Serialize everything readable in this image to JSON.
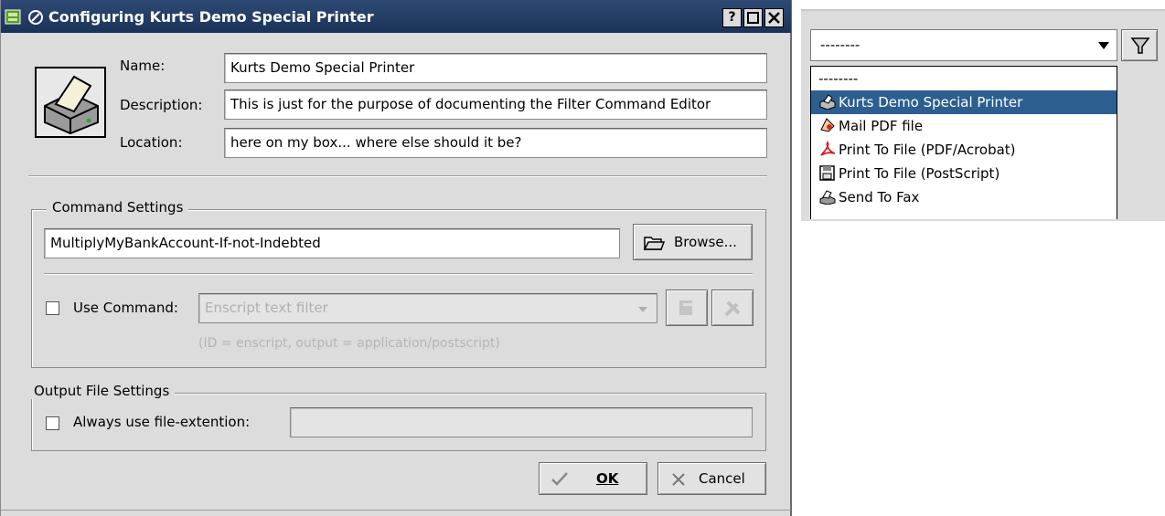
{
  "window": {
    "title": "Configuring Kurts Demo Special Printer",
    "buttons": {
      "help": "?",
      "maximize": "□",
      "close": "×"
    }
  },
  "printer": {
    "name_label": "Name:",
    "name_value": "Kurts Demo Special Printer",
    "description_label": "Description:",
    "description_value": "This is just for the purpose of documenting the Filter Command Editor",
    "location_label": "Location:",
    "location_value": "here on my box... where else should it be?"
  },
  "command_settings": {
    "group_title": "Command Settings",
    "command_value": "MultiplyMyBankAccount-If-not-Indebted",
    "browse_label": "Browse...",
    "use_command_label": "Use Command:",
    "use_command_checked": false,
    "command_select_value": "Enscript text filter",
    "info_text": "(ID = enscript, output = application/postscript)"
  },
  "output_settings": {
    "group_title": "Output File Settings",
    "always_use_ext_label": "Always use file-extention:",
    "always_use_ext_checked": false,
    "ext_value": ""
  },
  "actions": {
    "ok_label": "OK",
    "cancel_label": "Cancel"
  },
  "combo": {
    "selected_value": "--------",
    "options": [
      {
        "label": "--------",
        "icon": "none"
      },
      {
        "label": "Kurts Demo Special Printer",
        "icon": "printer-icon",
        "selected": true
      },
      {
        "label": "Mail PDF file",
        "icon": "mail-pdf-icon"
      },
      {
        "label": "Print To File (PDF/Acrobat)",
        "icon": "acrobat-icon"
      },
      {
        "label": "Print To File (PostScript)",
        "icon": "floppy-icon"
      },
      {
        "label": "Send To Fax",
        "icon": "fax-icon"
      }
    ]
  },
  "colors": {
    "titlebar": "#1f3a66",
    "selection": "#2c5f90",
    "dialog_bg": "#dcdcdc"
  }
}
